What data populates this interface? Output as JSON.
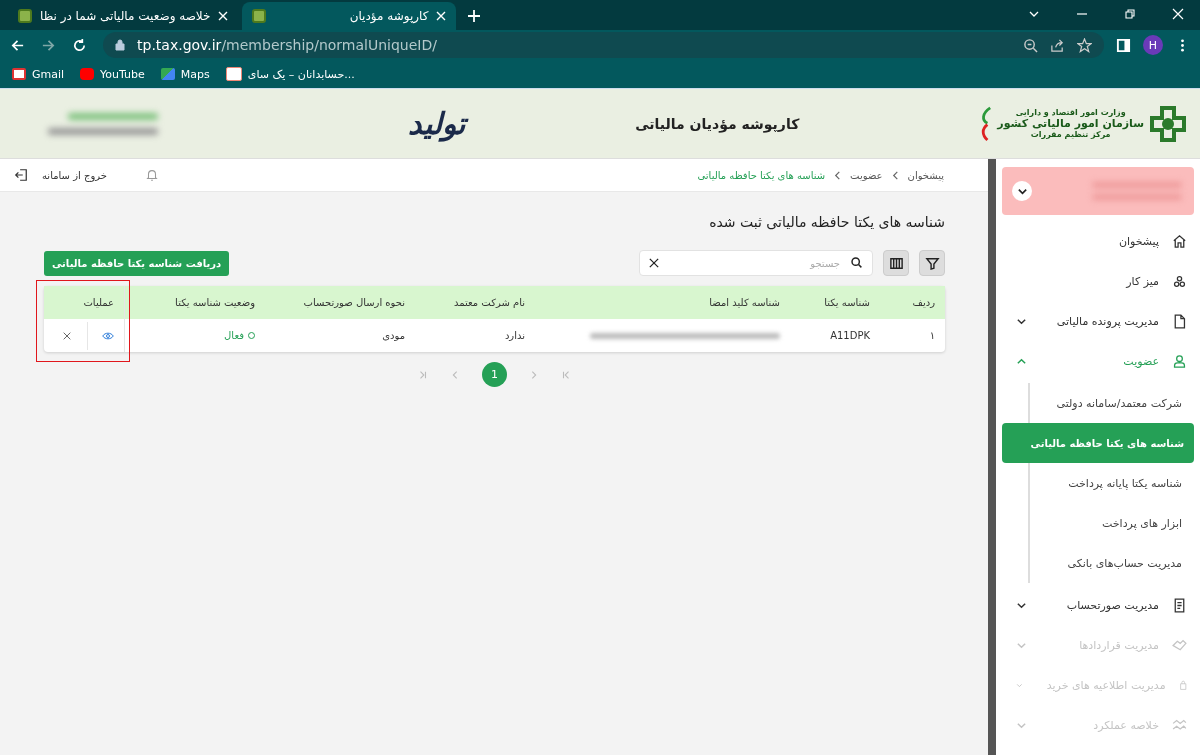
{
  "browser": {
    "tabs": [
      {
        "title": "کارپوشه مؤدیان",
        "selected": true
      },
      {
        "title": "خلاصه وضعیت مالیاتی شما در نظا",
        "selected": false
      }
    ],
    "url": {
      "host": "tp.tax.gov.ir",
      "path": "/membership/normalUniqueID/"
    },
    "bookmarks": [
      {
        "label": "حسابدانان – یک سای..."
      },
      {
        "label": "Maps"
      },
      {
        "label": "YouTube"
      },
      {
        "label": "Gmail"
      }
    ],
    "avatar": "H"
  },
  "header": {
    "title": "کارپوشه مؤدیان مالیاتی",
    "logo_lines": [
      "وزارت امور اقتصاد و دارایی",
      "سازمان امور مالیاتی کشور",
      "مرکز تنظیم مقررات"
    ],
    "calligraphy": "تولید"
  },
  "topbar": {
    "logout": "خروج از سامانه",
    "breadcrumbs": [
      {
        "label": "پیشخوان",
        "current": false
      },
      {
        "label": "عضویت",
        "current": false
      },
      {
        "label": "شناسه های یکتا حافظه مالیاتی",
        "current": true
      }
    ]
  },
  "page_title": "شناسه های یکتا حافظه مالیاتی ثبت شده",
  "request_button": "دریافت شناسه یکتا حافظه مالیاتی",
  "search": {
    "placeholder": "جستجو"
  },
  "table": {
    "columns": [
      "ردیف",
      "شناسه یکتا",
      "شناسه کلید امضا",
      "نام شرکت معتمد",
      "نحوه ارسال صورتحساب",
      "وضعیت شناسه یکتا",
      "عملیات"
    ],
    "rows": [
      {
        "row_no": "۱",
        "unique_id": "A11DPK",
        "company": "ندارد",
        "sending_method": "مودی",
        "status": "فعال"
      }
    ]
  },
  "pagination": [
    {
      "label": "1",
      "selected": true
    }
  ],
  "sidebar": {
    "items": [
      {
        "label": "پیشخوان",
        "kind": "link",
        "active": false,
        "disabled": false
      },
      {
        "label": "میز کار",
        "kind": "link",
        "active": false,
        "disabled": false
      },
      {
        "label": "مدیریت پرونده مالیاتی",
        "kind": "group",
        "expanded": false,
        "active": false,
        "disabled": false
      },
      {
        "label": "عضویت",
        "kind": "group",
        "expanded": true,
        "active": true,
        "disabled": false,
        "children": [
          {
            "label": "شرکت معتمد/سامانه دولتی",
            "selected": false
          },
          {
            "label": "شناسه های یکتا حافظه مالیاتی",
            "selected": true
          },
          {
            "label": "شناسه یکتا پایانه پرداخت",
            "selected": false
          },
          {
            "label": "ابزار های پرداخت",
            "selected": false
          },
          {
            "label": "مدیریت حساب‌های بانکی",
            "selected": false
          }
        ]
      },
      {
        "label": "مدیریت صورتحساب",
        "kind": "group",
        "expanded": false,
        "active": false,
        "disabled": false
      },
      {
        "label": "مدیریت قراردادها",
        "kind": "group",
        "expanded": false,
        "active": false,
        "disabled": true
      },
      {
        "label": "مدیریت اطلاعیه های خرید",
        "kind": "group",
        "expanded": false,
        "active": false,
        "disabled": true
      },
      {
        "label": "خلاصه عملکرد",
        "kind": "group",
        "expanded": false,
        "active": false,
        "disabled": true
      }
    ]
  }
}
